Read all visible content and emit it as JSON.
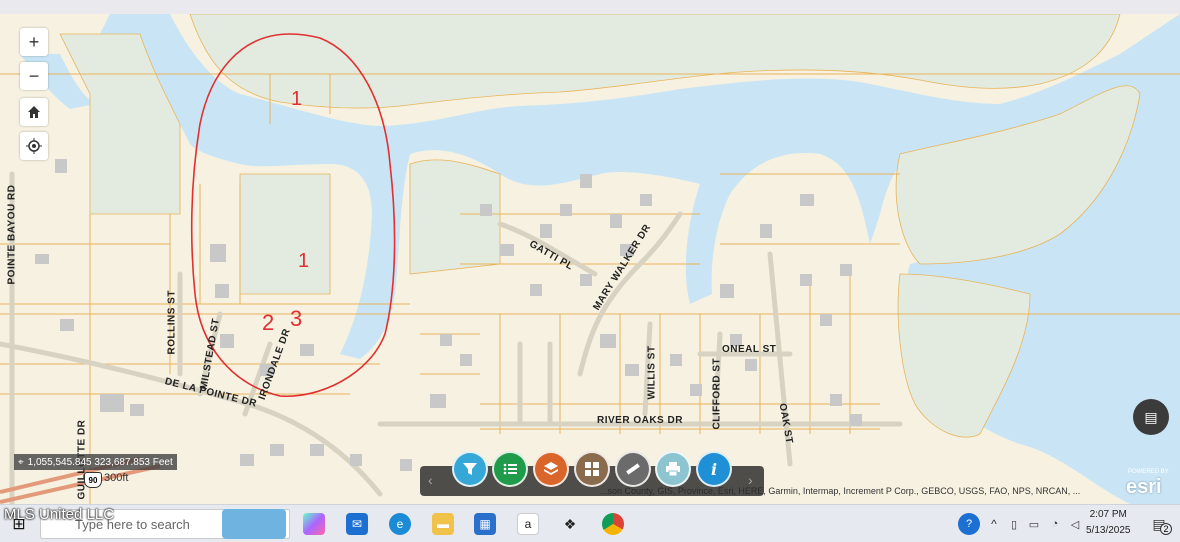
{
  "map": {
    "zoom_in": "+",
    "zoom_out": "−",
    "home_icon": "home-icon",
    "locate_icon": "locate-icon",
    "coordinates": "1,055,545.845 323,687.853 Feet",
    "scale_text": "300ft",
    "highway_shield": "90",
    "attribution": "...son County, GIS, Province, Esri, HERE, Garmin, Intermap, Increment P Corp., GEBCO, USGS, FAO, NPS, NRCAN, ...",
    "esri_logo": "esri",
    "esri_powered": "POWERED BY",
    "annotations": [
      "1",
      "1",
      "2",
      "3"
    ],
    "road_labels": [
      "POINTE BAYOU RD",
      "ROLLINS ST",
      "MILSTEAD ST",
      "IRONDALE DR",
      "DE LA POINTE DR",
      "GUILLOTTE DR",
      "GATTI PL",
      "MARY WALKER DR",
      "WILLIS ST",
      "CLIFFORD ST",
      "ONEAL ST",
      "OAK ST",
      "RIVER OAKS DR"
    ],
    "colors": {
      "water": "#c9e5f5",
      "land": "#f6f1e1",
      "parcel": "#e8b45a",
      "marsh": "#dfe8df",
      "annotation": "#e03030"
    }
  },
  "toolbar": {
    "tools": [
      "filter-icon",
      "list-icon",
      "layers-icon",
      "basemap-icon",
      "measure-icon",
      "print-icon",
      "info-icon"
    ],
    "prev": "‹",
    "next": "›"
  },
  "taskbar": {
    "watermark": "MLS United LLC",
    "search_placeholder": "Type here to search",
    "time": "2:07 PM",
    "date": "5/13/2025",
    "notification_count": "2"
  }
}
